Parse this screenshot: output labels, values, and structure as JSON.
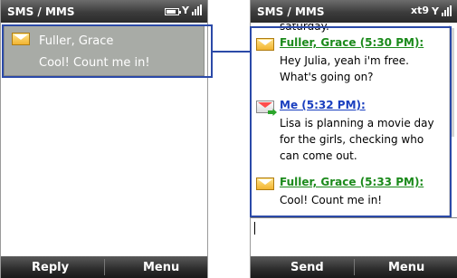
{
  "left": {
    "title": "SMS / MMS",
    "status": {
      "battery_icon": "battery-icon",
      "signal_icon": "signal-strength-icon"
    },
    "selected_message": {
      "sender": "Fuller, Grace",
      "preview": "Cool! Count me in!",
      "icon": "envelope-icon"
    },
    "softkeys": {
      "left": "Reply",
      "right": "Menu"
    }
  },
  "right": {
    "title": "SMS / MMS",
    "status": {
      "connection_label": "xt9",
      "signal_icon": "signal-strength-icon"
    },
    "thread": {
      "clipped_top": "saturday.",
      "messages": [
        {
          "header": "Fuller, Grace (5:30 PM):",
          "body": "Hey Julia, yeah i'm free. What's going on?"
        },
        {
          "header": "Me (5:32 PM):",
          "body": "Lisa is planning a movie day for the girls, checking who can come out."
        },
        {
          "header": "Fuller, Grace (5:33 PM):",
          "body": "Cool! Count me in!"
        }
      ]
    },
    "softkeys": {
      "left": "Send",
      "right": "Menu"
    }
  },
  "colors": {
    "incoming_header": "#1b8a1b",
    "outgoing_header": "#1a3fbf",
    "selected_bg": "#a8aba6",
    "callout": "#2b4aa8"
  }
}
